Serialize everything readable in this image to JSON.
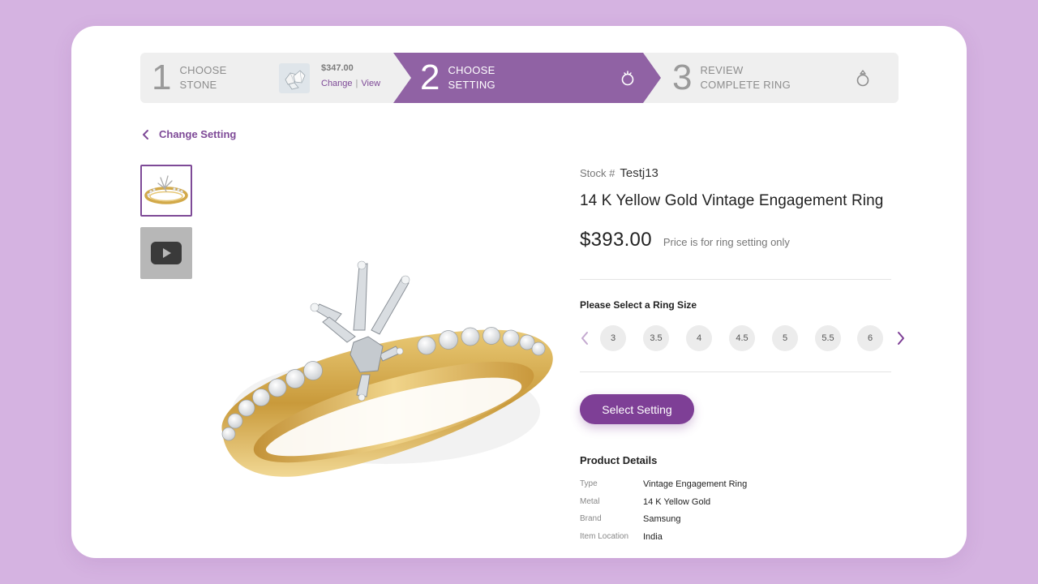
{
  "stepper": {
    "step1": {
      "number": "1",
      "line1": "CHOOSE",
      "line2": "STONE",
      "price": "$347.00",
      "change": "Change",
      "view": "View"
    },
    "step2": {
      "number": "2",
      "line1": "CHOOSE",
      "line2": "SETTING"
    },
    "step3": {
      "number": "3",
      "line1": "REVIEW",
      "line2": "COMPLETE RING"
    }
  },
  "back_link": "Change Setting",
  "product": {
    "stock_label": "Stock #",
    "stock_value": "Testj13",
    "title": "14 K Yellow Gold Vintage Engagement Ring",
    "price": "$393.00",
    "price_note": "Price is for ring setting only"
  },
  "ring_size": {
    "label": "Please Select a Ring Size",
    "sizes": [
      "3",
      "3.5",
      "4",
      "4.5",
      "5",
      "5.5",
      "6"
    ]
  },
  "select_button": "Select Setting",
  "details": {
    "title": "Product Details",
    "rows": [
      {
        "key": "Type",
        "value": "Vintage Engagement Ring"
      },
      {
        "key": "Metal",
        "value": "14 K Yellow Gold"
      },
      {
        "key": "Brand",
        "value": "Samsung"
      },
      {
        "key": "Item Location",
        "value": "India"
      }
    ]
  },
  "colors": {
    "accent": "#7e3f96",
    "active_step": "#9062a4",
    "page_background": "#d5b3e1"
  },
  "icons": [
    "ring-solitaire-icon",
    "ring-complete-icon",
    "chevron-left-icon",
    "chevron-right-icon",
    "play-icon"
  ]
}
